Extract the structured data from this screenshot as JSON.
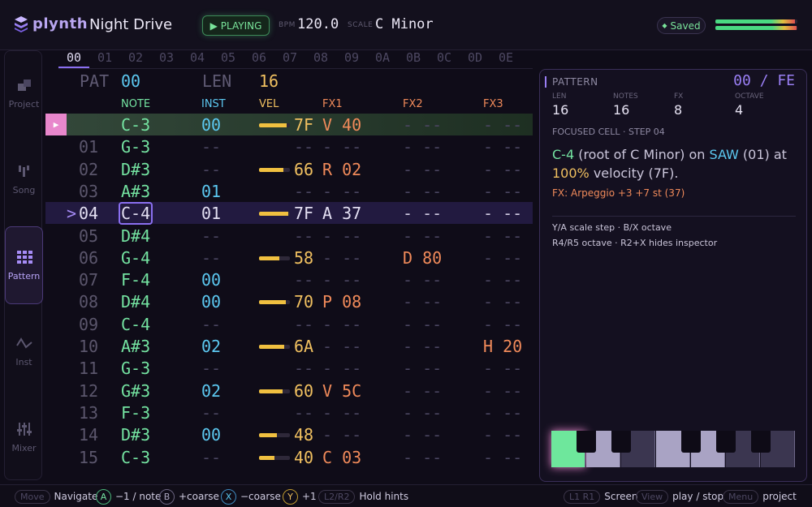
{
  "app": {
    "brand": "plynth",
    "song_title": "Night Drive"
  },
  "transport": {
    "status": "PLAYING",
    "bpm_label": "BPM",
    "bpm": "120.0",
    "scale_label": "SCALE",
    "scale": "C Minor",
    "saved": "Saved"
  },
  "meters": {
    "left": 0.97,
    "right": 0.99
  },
  "sidebar": [
    {
      "label": "Project",
      "icon": "project-icon"
    },
    {
      "label": "Song",
      "icon": "song-icon"
    },
    {
      "label": "Pattern",
      "icon": "pattern-grid-icon",
      "active": true
    },
    {
      "label": "Inst",
      "icon": "waveform-icon"
    },
    {
      "label": "Mixer",
      "icon": "mixer-sliders-icon"
    }
  ],
  "step_tabs": [
    "00",
    "01",
    "02",
    "03",
    "04",
    "05",
    "06",
    "07",
    "08",
    "09",
    "0A",
    "0B",
    "0C",
    "0D",
    "0E"
  ],
  "pattern": {
    "pat_label": "PAT",
    "pat": "00",
    "len_label": "LEN",
    "len": "16"
  },
  "columns": {
    "note": "NOTE",
    "inst": "INST",
    "vel": "VEL",
    "fx1": "FX1",
    "fx2": "FX2",
    "fx3": "FX3"
  },
  "rows": [
    {
      "step": "",
      "note": "C-3",
      "inst": "00",
      "vel": "7F",
      "vel_level": 0.9,
      "fx1": "V 40",
      "fx2": "- --",
      "fx3": "- --"
    },
    {
      "step": "01",
      "note": "G-3",
      "inst": "--",
      "vel": "--",
      "vel_level": 0,
      "fx1": "- --",
      "fx2": "- --",
      "fx3": "- --"
    },
    {
      "step": "02",
      "note": "D#3",
      "inst": "--",
      "vel": "66",
      "vel_level": 0.8,
      "fx1": "R 02",
      "fx2": "- --",
      "fx3": "- --"
    },
    {
      "step": "03",
      "note": "A#3",
      "inst": "01",
      "vel": "--",
      "vel_level": 0,
      "fx1": "- --",
      "fx2": "- --",
      "fx3": "- --"
    },
    {
      "step": "04",
      "note": "C-4",
      "inst": "01",
      "vel": "7F",
      "vel_level": 0.95,
      "fx1": "A 37",
      "fx2": "- --",
      "fx3": "- --"
    },
    {
      "step": "05",
      "note": "D#4",
      "inst": "--",
      "vel": "--",
      "vel_level": 0,
      "fx1": "- --",
      "fx2": "- --",
      "fx3": "- --"
    },
    {
      "step": "06",
      "note": "G-4",
      "inst": "--",
      "vel": "58",
      "vel_level": 0.65,
      "fx1": "- --",
      "fx2": "D 80",
      "fx3": "- --"
    },
    {
      "step": "07",
      "note": "F-4",
      "inst": "00",
      "vel": "--",
      "vel_level": 0,
      "fx1": "- --",
      "fx2": "- --",
      "fx3": "- --"
    },
    {
      "step": "08",
      "note": "D#4",
      "inst": "00",
      "vel": "70",
      "vel_level": 0.88,
      "fx1": "P 08",
      "fx2": "- --",
      "fx3": "- --"
    },
    {
      "step": "09",
      "note": "C-4",
      "inst": "--",
      "vel": "--",
      "vel_level": 0,
      "fx1": "- --",
      "fx2": "- --",
      "fx3": "- --"
    },
    {
      "step": "10",
      "note": "A#3",
      "inst": "02",
      "vel": "6A",
      "vel_level": 0.82,
      "fx1": "- --",
      "fx2": "- --",
      "fx3": "H 20"
    },
    {
      "step": "11",
      "note": "G-3",
      "inst": "--",
      "vel": "--",
      "vel_level": 0,
      "fx1": "- --",
      "fx2": "- --",
      "fx3": "- --"
    },
    {
      "step": "12",
      "note": "G#3",
      "inst": "02",
      "vel": "60",
      "vel_level": 0.75,
      "fx1": "V 5C",
      "fx2": "- --",
      "fx3": "- --"
    },
    {
      "step": "13",
      "note": "F-3",
      "inst": "--",
      "vel": "--",
      "vel_level": 0,
      "fx1": "- --",
      "fx2": "- --",
      "fx3": "- --"
    },
    {
      "step": "14",
      "note": "D#3",
      "inst": "00",
      "vel": "48",
      "vel_level": 0.57,
      "fx1": "- --",
      "fx2": "- --",
      "fx3": "- --"
    },
    {
      "step": "15",
      "note": "C-3",
      "inst": "--",
      "vel": "40",
      "vel_level": 0.5,
      "fx1": "C 03",
      "fx2": "- --",
      "fx3": "- --"
    }
  ],
  "playing_row": 0,
  "focused_row": 4,
  "cursor_glyph": ">",
  "inspector": {
    "title": "PATTERN",
    "position": "00 / FE",
    "stats": [
      {
        "label": "LEN",
        "value": "16"
      },
      {
        "label": "NOTES",
        "value": "16"
      },
      {
        "label": "FX",
        "value": "8"
      },
      {
        "label": "OCTAVE",
        "value": "4"
      }
    ],
    "focus_head": "FOCUSED CELL · STEP 04",
    "desc_note": "C-4",
    "desc_1": " (root of C Minor) on ",
    "desc_inst": "SAW",
    "desc_2": " (01) at ",
    "desc_vel": "100%",
    "desc_3": " velocity (7F).",
    "fx_line": "FX: Arpeggio +3 +7 st (37)",
    "hint_1": "Y/A scale step · B/X octave",
    "hint_2": "R4/R5 octave · R2+X hides inspector"
  },
  "bottom_hints": {
    "move_chip": "Move",
    "move_text": "Navigate",
    "a_key": "A",
    "a_text": "−1 / note",
    "b_key": "B",
    "b_text": "+coarse",
    "x_key": "X",
    "x_text": "−coarse",
    "y_key": "Y",
    "y_text": "+1",
    "l2r2_chip": "L2/R2",
    "l2r2_text": "Hold hints",
    "l1r1_chip": "L1 R1",
    "l1r1_text": "Screen",
    "view_chip": "View",
    "view_text": "play / stop",
    "menu_chip": "Menu",
    "menu_text": "project"
  },
  "colors": {
    "accent": "#8a6ff0",
    "note": "#74e3a1",
    "inst": "#5cc8f0",
    "vel": "#f0c060",
    "fx": "#f08a5a",
    "play_marker": "#e887cc"
  }
}
